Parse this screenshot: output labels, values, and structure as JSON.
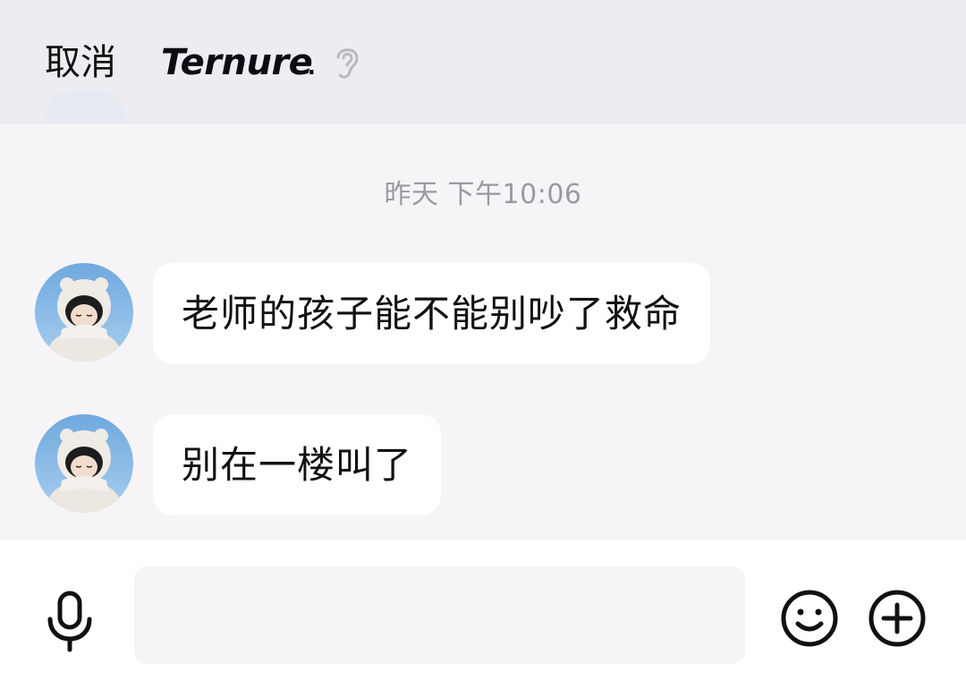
{
  "header": {
    "cancel_label": "取消",
    "title": "Ternure",
    "title_suffix": "."
  },
  "chat": {
    "timestamp": "昨天 下午10:06",
    "messages": [
      {
        "text": "老师的孩子能不能别吵了救命"
      },
      {
        "text": "别在一楼叫了"
      }
    ]
  },
  "input": {
    "placeholder": "",
    "value": ""
  },
  "icons": {
    "header_ear": "ear-icon",
    "mic": "microphone-icon",
    "emoji": "smiley-face-icon",
    "plus": "plus-circle-icon"
  },
  "colors": {
    "header_bg": "#efecf1",
    "chat_bg": "#f6f4f7",
    "bubble_bg": "#ffffff",
    "timestamp_text": "#9a9a9f",
    "input_bg": "#f5f5f5"
  }
}
